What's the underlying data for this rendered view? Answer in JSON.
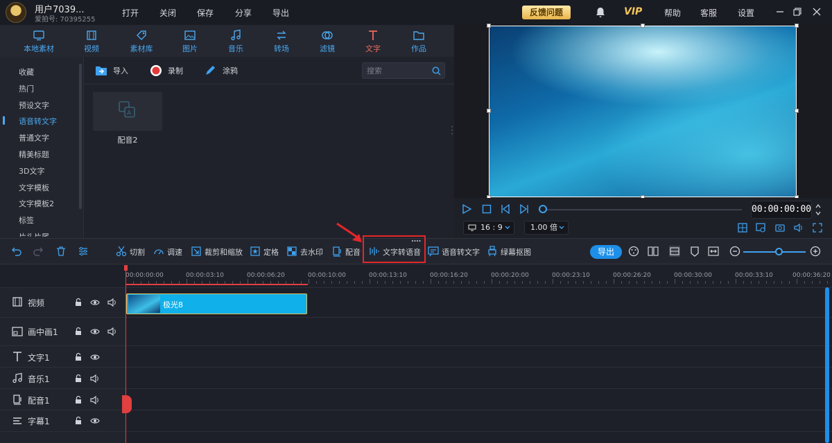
{
  "titlebar": {
    "user_name": "用户7039...",
    "user_id": "爱拍号: 70395255",
    "menu": [
      "打开",
      "关闭",
      "保存",
      "分享",
      "导出"
    ],
    "feedback": "反馈问题",
    "vip": "VIP",
    "right_menu": [
      "帮助",
      "客服",
      "设置"
    ]
  },
  "category_tabs": [
    {
      "label": "本地素材",
      "icon": "monitor-icon"
    },
    {
      "label": "视频",
      "icon": "film-icon"
    },
    {
      "label": "素材库",
      "icon": "tag-icon"
    },
    {
      "label": "图片",
      "icon": "image-icon"
    },
    {
      "label": "音乐",
      "icon": "music-icon"
    },
    {
      "label": "转场",
      "icon": "transition-icon"
    },
    {
      "label": "滤镜",
      "icon": "filter-icon"
    },
    {
      "label": "文字",
      "icon": "text-icon",
      "active": true
    },
    {
      "label": "作品",
      "icon": "folder-icon"
    }
  ],
  "left_nav": [
    {
      "label": "收藏"
    },
    {
      "label": "热门"
    },
    {
      "label": "预设文字"
    },
    {
      "label": "语音转文字",
      "active": true
    },
    {
      "label": "普通文字"
    },
    {
      "label": "精美标题"
    },
    {
      "label": "3D文字"
    },
    {
      "label": "文字模板"
    },
    {
      "label": "文字模板2"
    },
    {
      "label": "标签"
    },
    {
      "label": "片头片尾"
    }
  ],
  "content_toolbar": {
    "import": "导入",
    "record": "录制",
    "doodle": "涂鸦",
    "search_placeholder": "搜索"
  },
  "media_items": [
    {
      "label": "配音2"
    }
  ],
  "player": {
    "timecode": "00:00:00:00",
    "aspect": "16 : 9",
    "speed": "1.00 倍",
    "progress": 0
  },
  "edit_toolbar": {
    "cut": "切割",
    "speed": "调速",
    "crop": "裁剪和缩放",
    "freeze": "定格",
    "watermark": "去水印",
    "dub": "配音",
    "tts": "文字转语音",
    "stt": "语音转文字",
    "greenscreen": "绿幕抠图",
    "export": "导出"
  },
  "timeline": {
    "ticks": [
      "00:00:00:00",
      "00:00:03:10",
      "00:00:06:20",
      "00:00:10:00",
      "00:00:13:10",
      "00:00:16:20",
      "00:00:20:00",
      "00:00:23:10",
      "00:00:26:20",
      "00:00:30:00",
      "00:00:33:10",
      "00:00:36:20"
    ],
    "tracks": [
      {
        "name": "视频",
        "icon": "film-icon"
      },
      {
        "name": "画中画1",
        "icon": "pip-icon"
      },
      {
        "name": "文字1",
        "icon": "text-icon"
      },
      {
        "name": "音乐1",
        "icon": "music-icon"
      },
      {
        "name": "配音1",
        "icon": "mic-icon"
      },
      {
        "name": "字幕1",
        "icon": "subtitle-icon"
      }
    ],
    "clip_label": "极光8"
  },
  "colors": {
    "accent": "#4aa9f0",
    "active_tab": "#f26b5b",
    "highlight": "#e5262a",
    "playhead": "#e04040",
    "clip": "#10b0ea"
  }
}
